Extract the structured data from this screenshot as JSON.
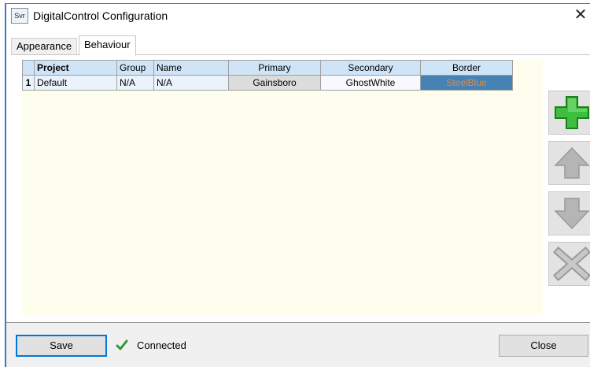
{
  "window": {
    "title": "DigitalControl Configuration",
    "icon_text": "Svr",
    "close_glyph": "✕"
  },
  "tabs": [
    {
      "label": "Appearance",
      "active": false
    },
    {
      "label": "Behaviour",
      "active": true
    }
  ],
  "grid": {
    "columns": [
      "Project",
      "Group",
      "Name",
      "Primary",
      "Secondary",
      "Border"
    ],
    "rows": [
      {
        "index": "1",
        "project": "Default",
        "group": "N/A",
        "name": "N/A",
        "primary": "Gainsboro",
        "secondary": "GhostWhite",
        "border": "SteelBlue"
      }
    ],
    "colors": {
      "header_bg": "#cfe4f7",
      "row_bg": "#eaf3fc",
      "area_bg": "#fdfeee",
      "primary_swatch": "#dcdcdc",
      "secondary_swatch": "#f8f8ff",
      "border_swatch": "#4682b4",
      "border_text": "#e58a3a"
    }
  },
  "side_buttons": [
    {
      "icon": "plus-icon",
      "enabled": true,
      "color": "#2fae2f"
    },
    {
      "icon": "arrow-up-icon",
      "enabled": false,
      "color": "#b5b5b5"
    },
    {
      "icon": "arrow-down-icon",
      "enabled": false,
      "color": "#b5b5b5"
    },
    {
      "icon": "delete-x-icon",
      "enabled": false,
      "color": "#b5b5b5"
    }
  ],
  "footer": {
    "save_label": "Save",
    "status_text": "Connected",
    "status_icon": "checkmark-icon",
    "status_color": "#2e9b2e",
    "close_label": "Close"
  }
}
